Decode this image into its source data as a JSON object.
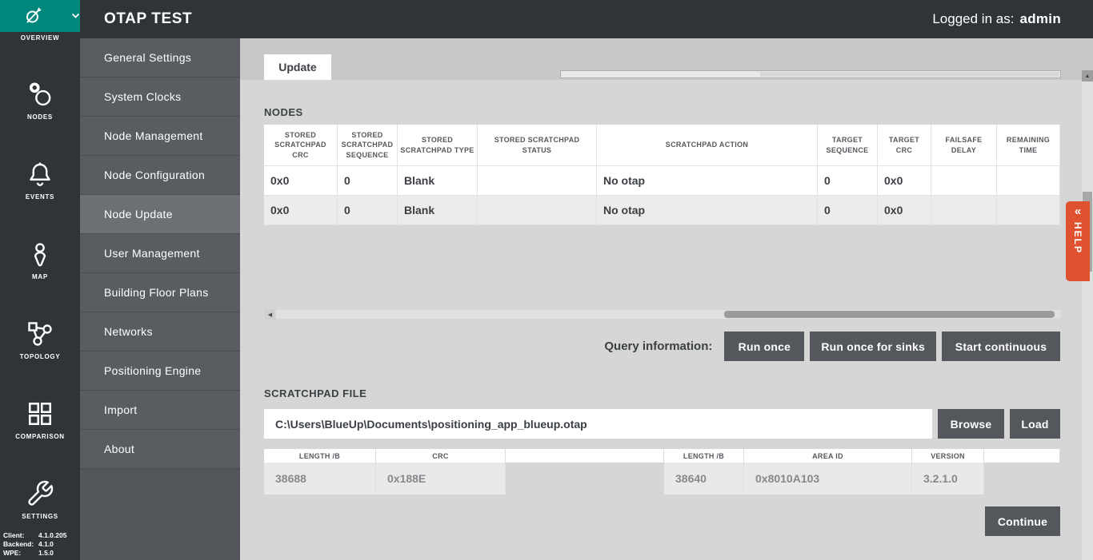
{
  "header": {
    "title": "OTAP TEST",
    "logged_in_label": "Logged in as:",
    "username": "admin"
  },
  "iconbar": {
    "overview": "OVERVIEW",
    "nodes": "NODES",
    "events": "EVENTS",
    "map": "MAP",
    "topology": "TOPOLOGY",
    "comparison": "COMPARISON",
    "settings": "SETTINGS",
    "versions": [
      {
        "label": "Client:",
        "value": "4.1.0.205"
      },
      {
        "label": "Backend:",
        "value": "4.1.0"
      },
      {
        "label": "WPE:",
        "value": "1.5.0"
      }
    ]
  },
  "sidebar": {
    "items": [
      {
        "label": "General Settings"
      },
      {
        "label": "System Clocks"
      },
      {
        "label": "Node Management"
      },
      {
        "label": "Node Configuration"
      },
      {
        "label": "Node Update"
      },
      {
        "label": "User Management"
      },
      {
        "label": "Building Floor Plans"
      },
      {
        "label": "Networks"
      },
      {
        "label": "Positioning Engine"
      },
      {
        "label": "Import"
      },
      {
        "label": "About"
      }
    ]
  },
  "main": {
    "tab_label": "Update",
    "nodes": {
      "title": "NODES",
      "columns": [
        "STORED SCRATCHPAD CRC",
        "STORED SCRATCHPAD SEQUENCE",
        "STORED SCRATCHPAD TYPE",
        "STORED SCRATCHPAD STATUS",
        "SCRATCHPAD ACTION",
        "TARGET SEQUENCE",
        "TARGET CRC",
        "FAILSAFE DELAY",
        "REMAINING TIME"
      ],
      "rows": [
        [
          "0x0",
          "0",
          "Blank",
          "",
          "No otap",
          "0",
          "0x0",
          "",
          ""
        ],
        [
          "0x0",
          "0",
          "Blank",
          "",
          "No otap",
          "0",
          "0x0",
          "",
          ""
        ]
      ]
    },
    "query": {
      "label": "Query information:",
      "run_once": "Run once",
      "run_once_sinks": "Run once for sinks",
      "start_continuous": "Start continuous"
    },
    "scratchpad": {
      "title": "SCRATCHPAD FILE",
      "file_path": "C:\\Users\\BlueUp\\Documents\\positioning_app_blueup.otap",
      "browse": "Browse",
      "load": "Load",
      "columns": [
        "LENGTH /B",
        "CRC",
        "",
        "LENGTH /B",
        "AREA ID",
        "VERSION",
        ""
      ],
      "values": [
        "38688",
        "0x188E",
        "",
        "38640",
        "0x8010A103",
        "3.2.1.0",
        ""
      ]
    },
    "continue_label": "Continue"
  },
  "help": {
    "label": "HELP",
    "collapse_icon": "«"
  },
  "colors": {
    "accent_teal": "#00887c",
    "dark": "#2f3438",
    "help_orange": "#e0512f",
    "button_gray": "#54585c"
  }
}
